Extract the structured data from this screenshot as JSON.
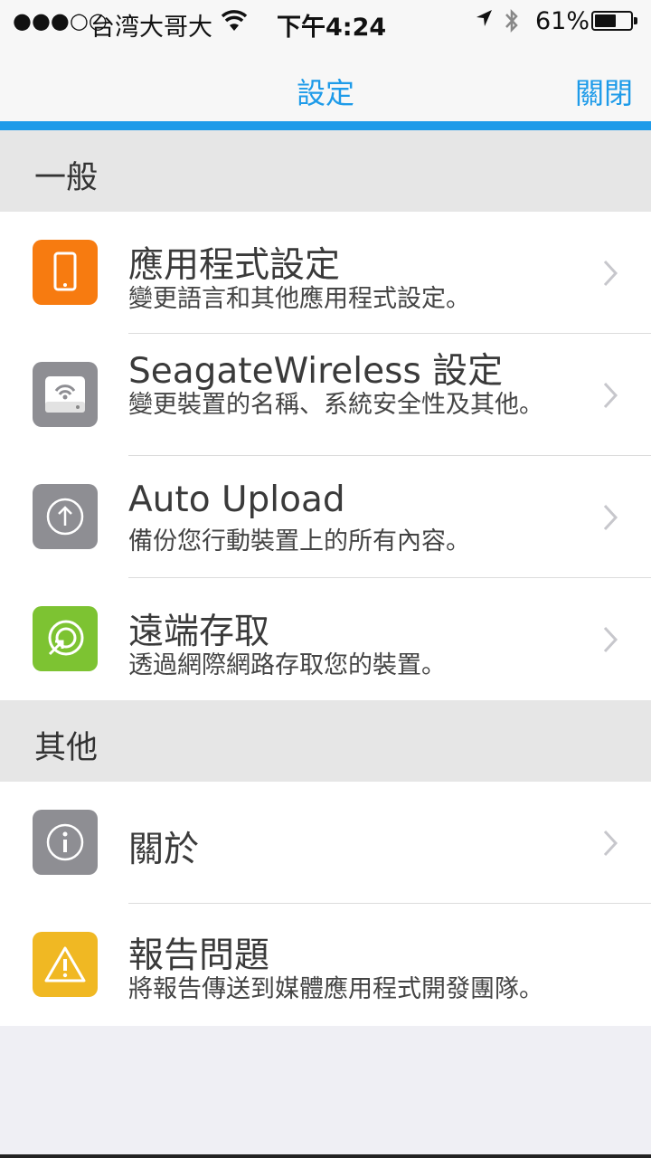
{
  "status_bar": {
    "signal": "●●●○○",
    "carrier": "台湾大哥大",
    "time": "下午4:24",
    "battery_percent": "61%",
    "battery_level": 0.61
  },
  "nav": {
    "title": "設定",
    "close_label": "關閉"
  },
  "sections": {
    "general": "一般",
    "other": "其他"
  },
  "items": {
    "app_settings": {
      "title": "應用程式設定",
      "subtitle": "變更語言和其他應用程式設定。",
      "icon": "phone-icon",
      "color": "#f77b10"
    },
    "seagate": {
      "title": "SeagateWireless 設定",
      "subtitle": "變更裝置的名稱、系統安全性及其他。",
      "icon": "drive-icon",
      "color": "#8e8e93"
    },
    "auto_upload": {
      "title": "Auto Upload",
      "subtitle": "備份您行動裝置上的所有內容。",
      "icon": "upload-icon",
      "color": "#8e8e93"
    },
    "remote_access": {
      "title": "遠端存取",
      "subtitle": "透過網際網路存取您的裝置。",
      "icon": "remote-access-icon",
      "color": "#7dc332"
    },
    "about": {
      "title": "關於",
      "icon": "info-icon",
      "color": "#8e8e93"
    },
    "report": {
      "title": "報告問題",
      "subtitle": "將報告傳送到媒體應用程式開發團隊。",
      "icon": "warning-icon",
      "color": "#f0b823"
    }
  },
  "colors": {
    "accent": "#1e9be9",
    "background": "#efeff4",
    "section_header": "#e6e6e6"
  }
}
